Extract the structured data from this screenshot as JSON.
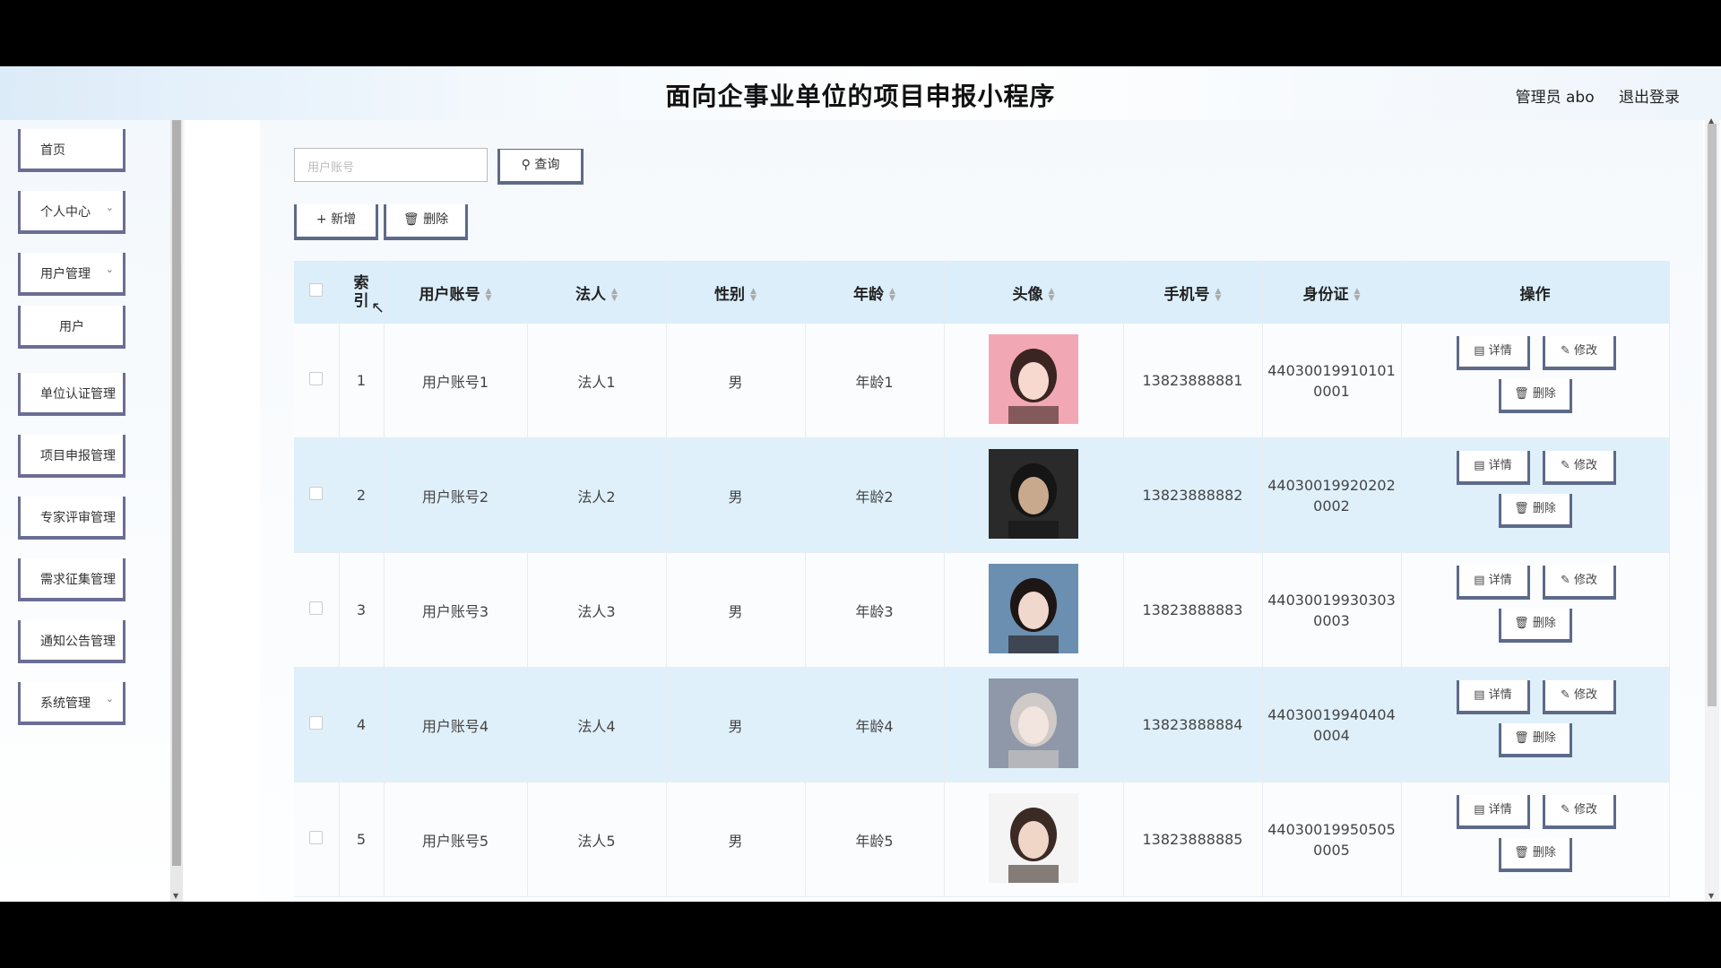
{
  "header": {
    "title": "面向企事业单位的项目申报小程序",
    "user": "管理员 abo",
    "logout": "退出登录"
  },
  "sidebar": {
    "items": [
      {
        "label": "首页"
      },
      {
        "label": "个人中心"
      },
      {
        "label": "用户管理"
      },
      {
        "label": "用户"
      },
      {
        "label": "单位认证管理"
      },
      {
        "label": "项目申报管理"
      },
      {
        "label": "专家评审管理"
      },
      {
        "label": "需求征集管理"
      },
      {
        "label": "通知公告管理"
      },
      {
        "label": "系统管理"
      }
    ]
  },
  "search": {
    "placeholder": "用户账号",
    "query_label": "查询"
  },
  "toolbar": {
    "add_label": "新增",
    "delete_label": "删除"
  },
  "table": {
    "headers": [
      "索引",
      "用户账号",
      "法人",
      "性别",
      "年龄",
      "头像",
      "手机号",
      "身份证",
      "操作"
    ],
    "index_header_line1": "索",
    "index_header_line2": "引",
    "rows": [
      {
        "index": "1",
        "account": "用户账号1",
        "legal": "法人1",
        "gender": "男",
        "age": "年龄1",
        "phone": "13823888881",
        "id_line1": "44030019910101",
        "id_line2": "0001"
      },
      {
        "index": "2",
        "account": "用户账号2",
        "legal": "法人2",
        "gender": "男",
        "age": "年龄2",
        "phone": "13823888882",
        "id_line1": "44030019920202",
        "id_line2": "0002"
      },
      {
        "index": "3",
        "account": "用户账号3",
        "legal": "法人3",
        "gender": "男",
        "age": "年龄3",
        "phone": "13823888883",
        "id_line1": "44030019930303",
        "id_line2": "0003"
      },
      {
        "index": "4",
        "account": "用户账号4",
        "legal": "法人4",
        "gender": "男",
        "age": "年龄4",
        "phone": "13823888884",
        "id_line1": "44030019940404",
        "id_line2": "0004"
      },
      {
        "index": "5",
        "account": "用户账号5",
        "legal": "法人5",
        "gender": "男",
        "age": "年龄5",
        "phone": "13823888885",
        "id_line1": "44030019950505",
        "id_line2": "0005"
      }
    ],
    "op_detail": "详情",
    "op_edit": "修改",
    "op_delete": "删除"
  },
  "icons": {
    "search": "search-icon",
    "plus": "plus-icon",
    "trash": "trash-icon",
    "detail": "document-icon",
    "edit": "pencil-icon",
    "sort": "sort-icon",
    "chevron": "chevron-down-icon"
  }
}
